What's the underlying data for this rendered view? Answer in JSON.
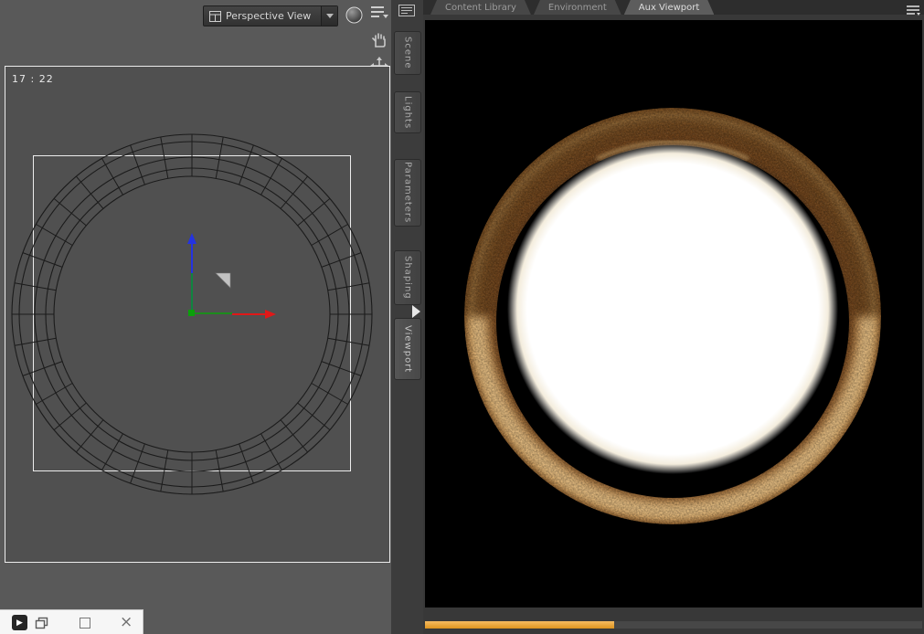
{
  "view_selector": {
    "label": "Perspective View"
  },
  "viewport": {
    "frame_counter": "17 : 22"
  },
  "dock": {
    "items": [
      "Scene",
      "Lights",
      "Parameters",
      "Shaping",
      "Viewport"
    ]
  },
  "right_panel": {
    "tabs": [
      {
        "label": "Content Library",
        "active": false
      },
      {
        "label": "Environment",
        "active": false
      },
      {
        "label": "Aux Viewport",
        "active": true
      }
    ],
    "progress_percent": 38
  },
  "side_tools": {
    "icons": [
      "pan-hand",
      "move",
      "zoom",
      "frame-region",
      "orbit"
    ]
  },
  "top_tools": {
    "icons": [
      "sphere",
      "view-presets"
    ]
  },
  "taskbar": {
    "icons": [
      "app",
      "restore-window",
      "maximize",
      "close"
    ]
  },
  "colors": {
    "accent_orange": "#e8a33d",
    "copper": "#a96a2e",
    "render_bg": "#000000"
  }
}
